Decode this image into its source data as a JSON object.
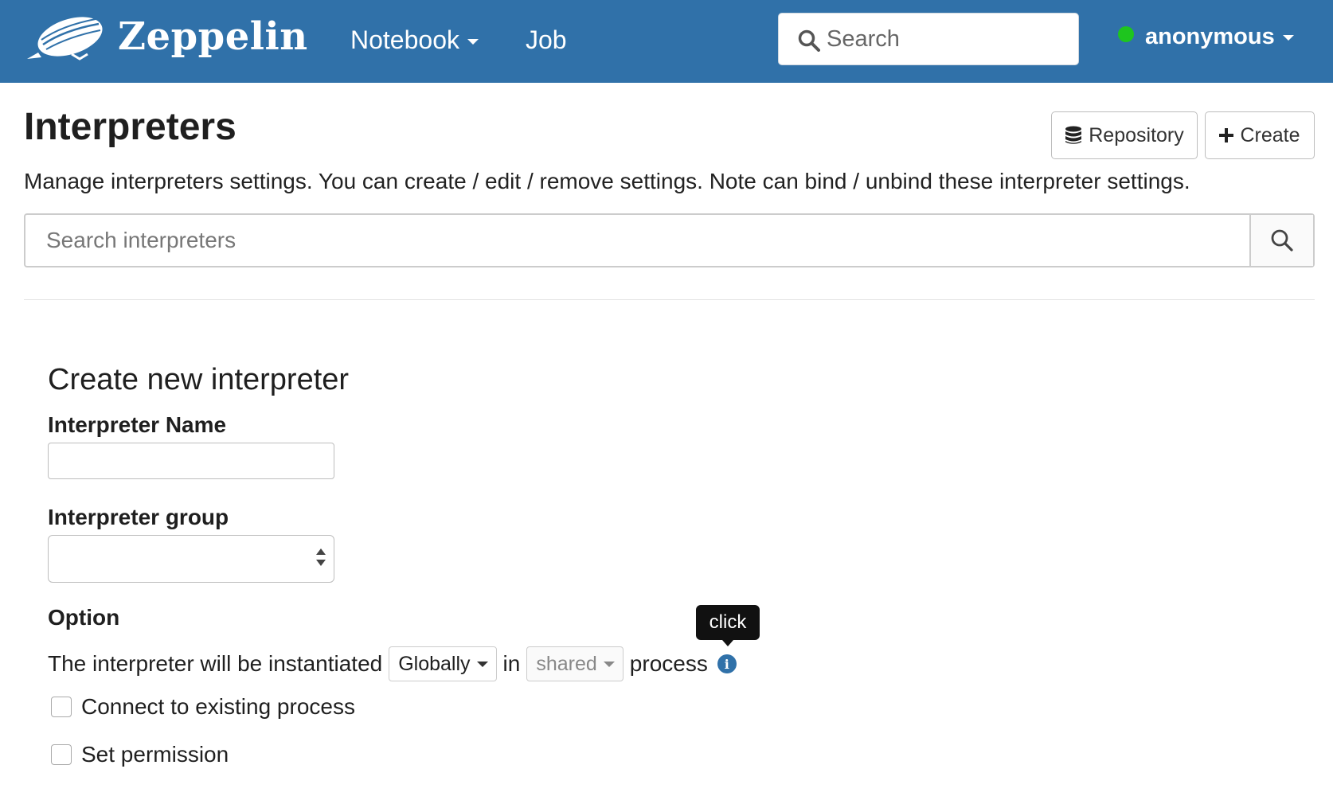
{
  "navbar": {
    "brand": "Zeppelin",
    "links": [
      {
        "label": "Notebook",
        "has_dropdown": true
      },
      {
        "label": "Job",
        "has_dropdown": false
      }
    ],
    "search": {
      "placeholder": "Search",
      "value": ""
    },
    "user": {
      "name": "anonymous",
      "status_color": "#1ec51e"
    },
    "background_color": "#3071a9"
  },
  "header": {
    "title": "Interpreters",
    "description": "Manage interpreters settings. You can create / edit / remove settings. Note can bind / unbind these interpreter settings.",
    "buttons": {
      "repository": {
        "label": "Repository",
        "icon": "database-icon"
      },
      "create": {
        "label": "Create",
        "icon": "plus-icon"
      }
    }
  },
  "filter": {
    "placeholder": "Search interpreters",
    "value": "",
    "icon": "search-icon"
  },
  "create_form": {
    "title": "Create new interpreter",
    "name_field": {
      "label": "Interpreter Name",
      "value": ""
    },
    "group_field": {
      "label": "Interpreter group",
      "selected": ""
    },
    "option": {
      "label": "Option",
      "sentence_start": "The interpreter will be instantiated",
      "scope_selected": "Globally",
      "connector": "in",
      "mode_selected": "shared",
      "sentence_end": "process",
      "info_icon": "info-icon",
      "tooltip": "click"
    },
    "checkboxes": [
      {
        "label": "Connect to existing process",
        "checked": false
      },
      {
        "label": "Set permission",
        "checked": false
      }
    ]
  }
}
